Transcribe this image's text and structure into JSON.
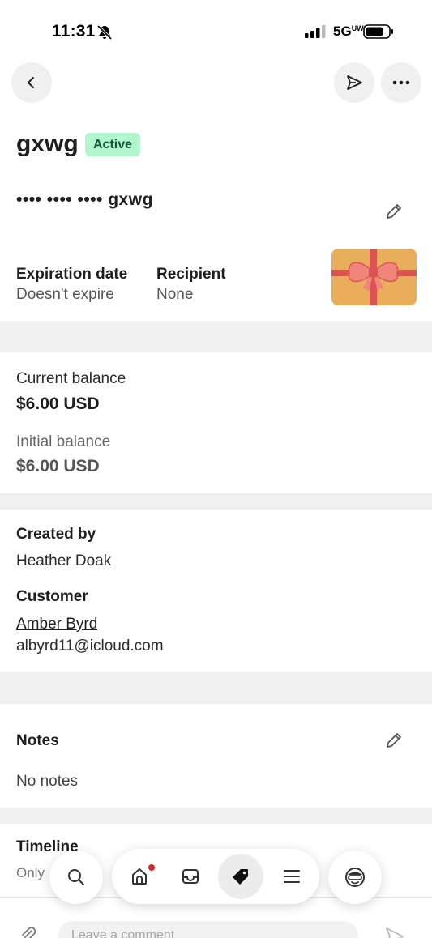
{
  "status_bar": {
    "time": "11:31",
    "network": "5G",
    "network_suffix": "UW"
  },
  "header": {
    "title": "gxwg",
    "status": "Active"
  },
  "card": {
    "number_masked": "•••• •••• •••• gxwg",
    "expiration_label": "Expiration date",
    "expiration_value": "Doesn't expire",
    "recipient_label": "Recipient",
    "recipient_value": "None"
  },
  "balance": {
    "current_label": "Current balance",
    "current_value": "$6.00 USD",
    "initial_label": "Initial balance",
    "initial_value": "$6.00 USD"
  },
  "details": {
    "created_by_label": "Created by",
    "created_by_value": "Heather Doak",
    "customer_label": "Customer",
    "customer_name": "Amber Byrd",
    "customer_email": "albyrd11@icloud.com"
  },
  "notes": {
    "label": "Notes",
    "value": "No notes"
  },
  "timeline": {
    "label": "Timeline",
    "subtitle": "Only"
  },
  "comment": {
    "placeholder": "Leave a comment"
  },
  "colors": {
    "badge_bg": "#b3f5cf",
    "badge_text": "#0d5a33",
    "gift_card": "#e9ae5c",
    "gift_ribbon": "#d9534f",
    "notification": "#d8232a"
  }
}
